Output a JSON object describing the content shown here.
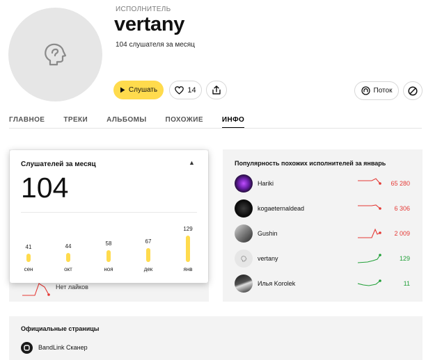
{
  "header": {
    "kicker": "ИСПОЛНИТЕЛЬ",
    "artist_name": "vertany",
    "listeners_text": "104 слушателя за месяц"
  },
  "actions": {
    "listen_label": "Слушать",
    "like_count": "14",
    "flow_label": "Поток"
  },
  "tabs": [
    {
      "label": "ГЛАВНОЕ",
      "active": false
    },
    {
      "label": "ТРЕКИ",
      "active": false
    },
    {
      "label": "АЛЬБОМЫ",
      "active": false
    },
    {
      "label": "ПОХОЖИЕ",
      "active": false
    },
    {
      "label": "ИНФО",
      "active": true
    }
  ],
  "listeners_popup": {
    "title": "Слушателей за месяц",
    "big_number": "104",
    "bars": [
      {
        "month": "сен",
        "value": 41
      },
      {
        "month": "окт",
        "value": 44
      },
      {
        "month": "ноя",
        "value": 58
      },
      {
        "month": "дек",
        "value": 67
      },
      {
        "month": "янв",
        "value": 129
      }
    ]
  },
  "likes_panel": {
    "no_likes_label": "Нет лайков"
  },
  "popularity": {
    "title": "Популярность похожих исполнителей за январь",
    "rows": [
      {
        "name": "Hariki",
        "value": "65 280",
        "trend": "down",
        "color": "#e53935"
      },
      {
        "name": "kogaeternaldead",
        "value": "6 306",
        "trend": "down",
        "color": "#e53935"
      },
      {
        "name": "Gushin",
        "value": "2 009",
        "trend": "spike",
        "color": "#e53935"
      },
      {
        "name": "vertany",
        "value": "129",
        "trend": "up",
        "color": "#21a038"
      },
      {
        "name": "Илья Korolek",
        "value": "11",
        "trend": "up",
        "color": "#21a038"
      }
    ]
  },
  "official_pages": {
    "title": "Официальные страницы",
    "links": [
      {
        "label": "BandLink Сканер"
      }
    ]
  },
  "colors": {
    "accent_yellow": "#ffdb4d",
    "trend_down": "#e53935",
    "trend_up": "#21a038"
  }
}
